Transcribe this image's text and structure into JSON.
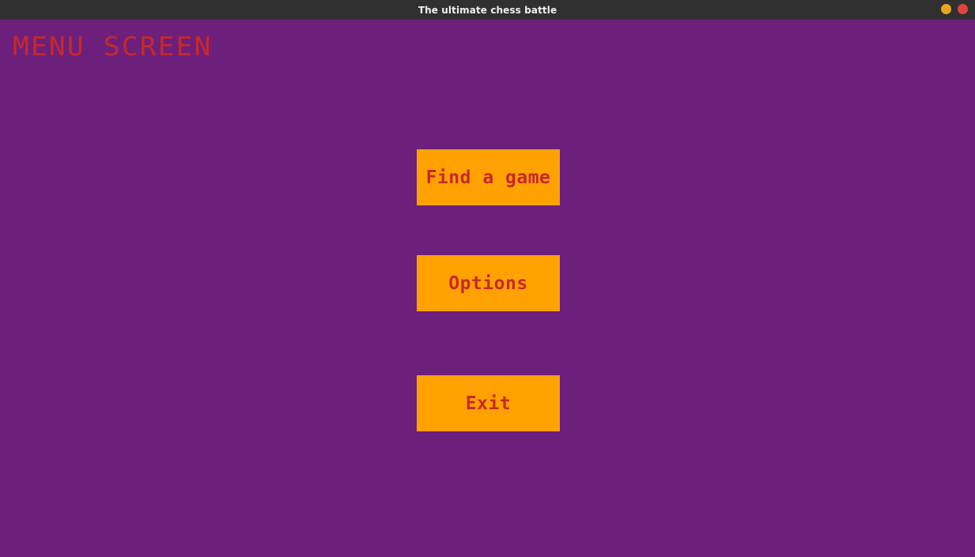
{
  "window": {
    "title": "The ultimate chess battle",
    "controls": {
      "minimize_color": "#e9a61c",
      "close_color": "#e0443e"
    }
  },
  "colors": {
    "background": "#6d1f7c",
    "titlebar": "#303030",
    "button_background": "#ffa200",
    "text_accent": "#c8282a"
  },
  "screen": {
    "title": "MENU SCREEN"
  },
  "menu": {
    "find_game_label": "Find a game",
    "options_label": "Options",
    "exit_label": "Exit"
  }
}
